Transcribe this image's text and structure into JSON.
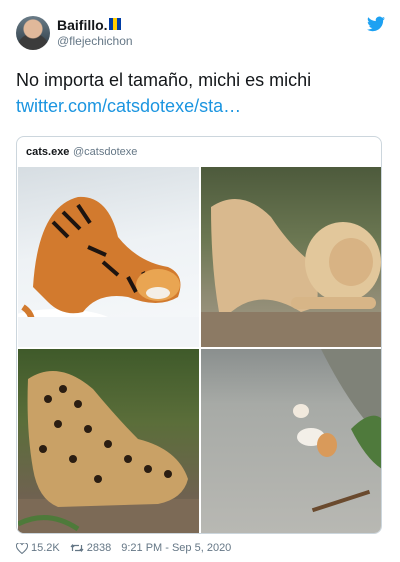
{
  "author": {
    "display_name": "Baifillo.",
    "handle": "@flejechichon",
    "flag_colors": [
      "#003da5",
      "#ffcc00",
      "#003da5"
    ]
  },
  "tweet": {
    "text": "No importa el tamaño, michi es michi",
    "link": "twitter.com/catsdotexe/sta…"
  },
  "quoted": {
    "name": "cats.exe",
    "handle": "@catsdotexe",
    "images": [
      "tiger-in-snow",
      "lion-stretching",
      "jaguar-stretching",
      "cat-stretching-on-road"
    ]
  },
  "footer": {
    "likes": "15.2K",
    "retweets": "2838",
    "time": "9:21 PM - Sep 5, 2020"
  },
  "colors": {
    "link": "#1b95e0",
    "brand": "#1da1f2",
    "muted": "#657786",
    "border": "#ccd6dd"
  }
}
